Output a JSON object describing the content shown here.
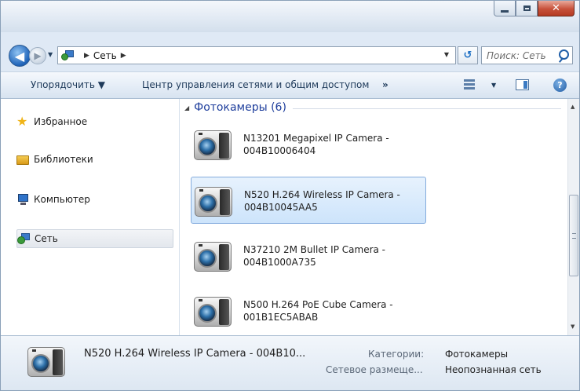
{
  "address": {
    "crumb": "Сеть",
    "search_placeholder": "Поиск: Сеть"
  },
  "toolbar": {
    "organize_label": "Упорядочить ▼",
    "network_center_label": "Центр управления сетями и общим доступом",
    "more_label": "»"
  },
  "nav": {
    "items": [
      {
        "label": "Избранное",
        "icon": "star-icon"
      },
      {
        "label": "Библиотеки",
        "icon": "libraries-icon"
      },
      {
        "label": "Компьютер",
        "icon": "computer-icon"
      },
      {
        "label": "Сеть",
        "icon": "network-icon",
        "selected": true
      }
    ]
  },
  "content": {
    "group_title": "Фотокамеры (6)",
    "items": [
      {
        "line1": "N13201 Megapixel IP Camera -",
        "line2": "004B10006404",
        "selected": false
      },
      {
        "line1": "N520 H.264 Wireless IP Camera -",
        "line2": "004B10045AA5",
        "selected": true
      },
      {
        "line1": "N37210 2M Bullet IP Camera -",
        "line2": "004B1000A735",
        "selected": false
      },
      {
        "line1": "N500 H.264 PoE Cube Camera -",
        "line2": "001B1EC5ABAB",
        "selected": false
      }
    ]
  },
  "details": {
    "name": "N520 H.264 Wireless IP Camera - 004B10...",
    "category_label": "Категории:",
    "category_value": "Фотокамеры",
    "location_label": "Сетевое размеще...",
    "location_value": "Неопознанная сеть"
  },
  "colors": {
    "group_title": "#1e3e9c",
    "selection_bg": "#cde4fb",
    "selection_border": "#84acdd",
    "close_button": "#c7513a"
  }
}
